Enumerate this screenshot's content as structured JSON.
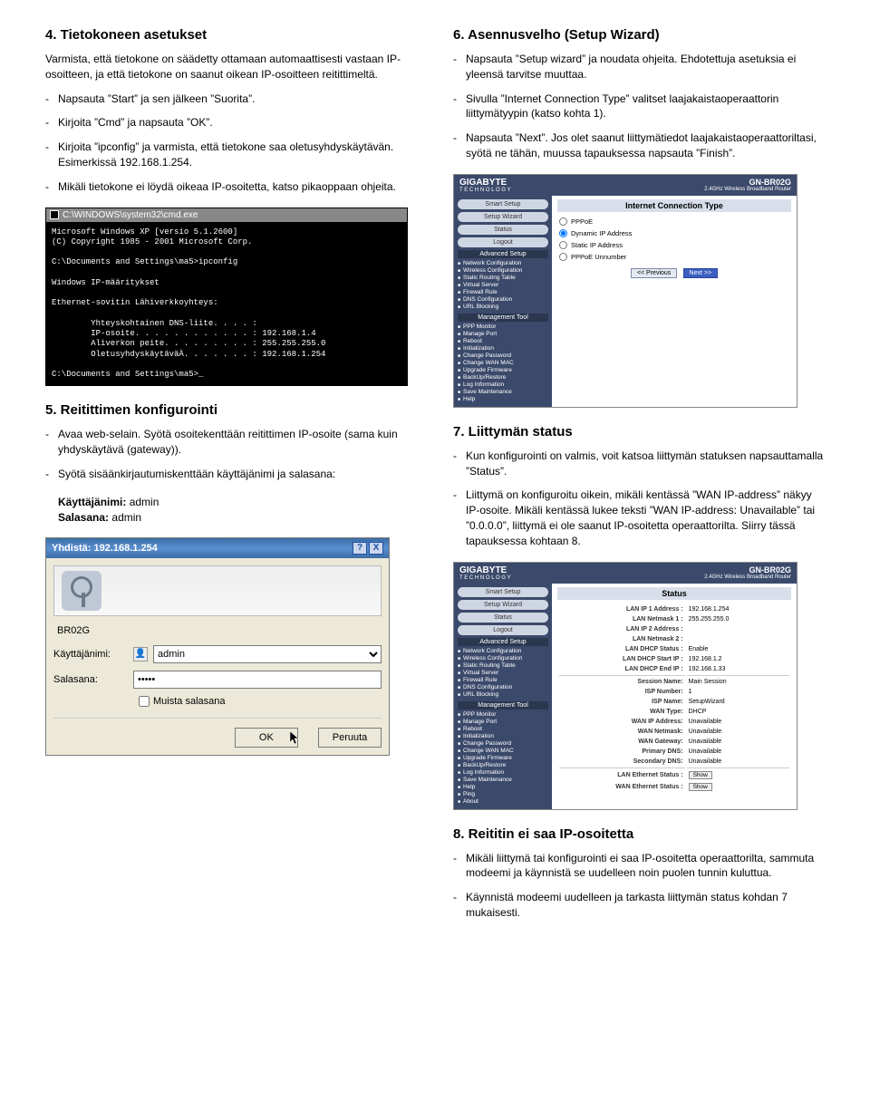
{
  "section4": {
    "title": "4. Tietokoneen asetukset",
    "intro": "Varmista, että tietokone on säädetty ottamaan automaattisesti vastaan IP-osoitteen, ja että tietokone on saanut oikean IP-osoitteen reitittimeltä.",
    "items": [
      "Napsauta ”Start” ja sen jälkeen ”Suorita”.",
      "Kirjoita ”Cmd” ja napsauta ”OK”.",
      "Kirjoita ”ipconfig” ja varmista, että tietokone saa oletusyhdyskäytävän. Esimerkissä 192.168.1.254.",
      "Mikäli tietokone ei löydä oikeaa IP-osoitetta, katso pikaoppaan ohjeita."
    ]
  },
  "cmd": {
    "title": "C:\\WINDOWS\\system32\\cmd.exe",
    "body": "Microsoft Windows XP [versio 5.1.2600]\n(C) Copyright 1985 - 2001 Microsoft Corp.\n\nC:\\Documents and Settings\\ma5>ipconfig\n\nWindows IP-määritykset\n\nEthernet-sovitin Lähiverkkoyhteys:\n\n        Yhteyskohtainen DNS-liite. . . . :\n        IP-osoite. . . . . . . . . . . . : 192.168.1.4\n        Aliverkon peite. . . . . . . . . : 255.255.255.0\n        OletusyhdyskäytäväÄ. . . . . . . : 192.168.1.254\n\nC:\\Documents and Settings\\ma5>_"
  },
  "section5": {
    "title": "5. Reitittimen konfigurointi",
    "items": [
      "Avaa web-selain. Syötä osoitekenttään reitittimen IP-osoite (sama kuin yhdyskäytävä (gateway)).",
      "Syötä sisäänkirjautumiskenttään käyttäjänimi ja salasana:"
    ],
    "user_label": "Käyttäjänimi:",
    "user_val": "admin",
    "pass_label": "Salasana:",
    "pass_val": "admin"
  },
  "login": {
    "title": "Yhdistä: 192.168.1.254",
    "realm": "BR02G",
    "user_label": "Käyttäjänimi:",
    "pass_label": "Salasana:",
    "user_value": "admin",
    "pass_value": "•••••",
    "remember": "Muista salasana",
    "ok": "OK",
    "cancel": "Peruuta",
    "help_btn": "?",
    "close_btn": "X"
  },
  "section6": {
    "title": "6. Asennusvelho (Setup Wizard)",
    "items": [
      "Napsauta ”Setup wizard” ja noudata ohjeita. Ehdotettuja asetuksia ei yleensä tarvitse muuttaa.",
      "Sivulla ”Internet Connection Type” valitset laajakaistaoperaattorin liittymätyypin (katso kohta 1).",
      "Napsauta ”Next”. Jos olet saanut  liittymätiedot laajakaistaoperaattoriltasi, syötä ne tähän, muussa tapauksessa napsauta ”Finish”."
    ]
  },
  "router_common": {
    "brand": "GIGABYTE",
    "brand_sub": "T E C H N O L O G Y",
    "model": "GN-BR02G",
    "model_sub": "2.4GHz Wireless Broadband Router",
    "buttons": {
      "smart": "Smart Setup",
      "wizard": "Setup Wizard",
      "status": "Status",
      "logout": "Logout"
    },
    "adv_title": "Advanced Setup",
    "adv_links": [
      "Network Configuration",
      "Wireless Configuration",
      "Static Routing Table",
      "Virtual Server",
      "Firewall Rule",
      "DNS Configuration",
      "URL Blocking"
    ],
    "mgmt_title": "Management Tool",
    "mgmt_links": [
      "PPP Monitor",
      "Manage Port",
      "Reboot",
      "Initialization",
      "Change Password",
      "Change WAN MAC",
      "Upgrade Firmware",
      "BackUp/Restore",
      "Log Information",
      "Save Maintenance",
      "Help"
    ],
    "mgmt_links_extra": [
      "Ping",
      "About"
    ]
  },
  "router_wizard": {
    "panel_title": "Internet Connection Type",
    "options": [
      "PPPoE",
      "Dynamic IP Address",
      "Static IP Address",
      "PPPoE Unnumber"
    ],
    "prev": "<< Previous",
    "next": "Next >>"
  },
  "section7": {
    "title": "7. Liittymän status",
    "items": [
      "Kun konfigurointi on valmis, voit katsoa liittymän statuksen napsauttamalla ”Status”.",
      "Liittymä on konfiguroitu oikein, mikäli kentässä ”WAN IP-address” näkyy IP-osoite. Mikäli kentässä lukee teksti ”WAN IP-address: Unavailable” tai ”0.0.0.0”, liittymä ei ole saanut IP-osoitetta operaattorilta. Siirry tässä tapauksessa kohtaan 8."
    ]
  },
  "router_status": {
    "panel_title": "Status",
    "rows": [
      {
        "k": "LAN IP 1 Address :",
        "v": "192.168.1.254"
      },
      {
        "k": "LAN Netmask 1 :",
        "v": "255.255.255.0"
      },
      {
        "k": "LAN IP 2 Address :",
        "v": ""
      },
      {
        "k": "LAN Netmask 2 :",
        "v": ""
      },
      {
        "k": "LAN DHCP Status :",
        "v": "Enable"
      },
      {
        "k": "LAN DHCP Start IP :",
        "v": "192.168.1.2"
      },
      {
        "k": "LAN DHCP End IP :",
        "v": "192.168.1.33"
      }
    ],
    "rows2": [
      {
        "k": "Session Name:",
        "v": "Main Session"
      },
      {
        "k": "ISP Number:",
        "v": "1"
      },
      {
        "k": "ISP Name:",
        "v": "SetupWizard"
      },
      {
        "k": "WAN Type:",
        "v": "DHCP"
      },
      {
        "k": "WAN IP Address:",
        "v": "Unavailable"
      },
      {
        "k": "WAN Netmask:",
        "v": "Unavailable"
      },
      {
        "k": "WAN Gateway:",
        "v": "Unavailable"
      },
      {
        "k": "Primary DNS:",
        "v": "Unavailable"
      },
      {
        "k": "Secondary DNS:",
        "v": "Unavailable"
      }
    ],
    "rows3": [
      {
        "k": "LAN Ethernet Status :",
        "btn": "Show"
      },
      {
        "k": "WAN Ethernet Status :",
        "btn": "Show"
      }
    ]
  },
  "section8": {
    "title": "8. Reititin ei saa IP-osoitetta",
    "items": [
      "Mikäli liittymä tai konfigurointi ei saa IP-osoitetta operaattorilta, sammuta modeemi ja käynnistä se uudelleen noin puolen tunnin kuluttua.",
      "Käynnistä modeemi uudelleen ja tarkasta liittymän status kohdan 7 mukaisesti."
    ]
  }
}
